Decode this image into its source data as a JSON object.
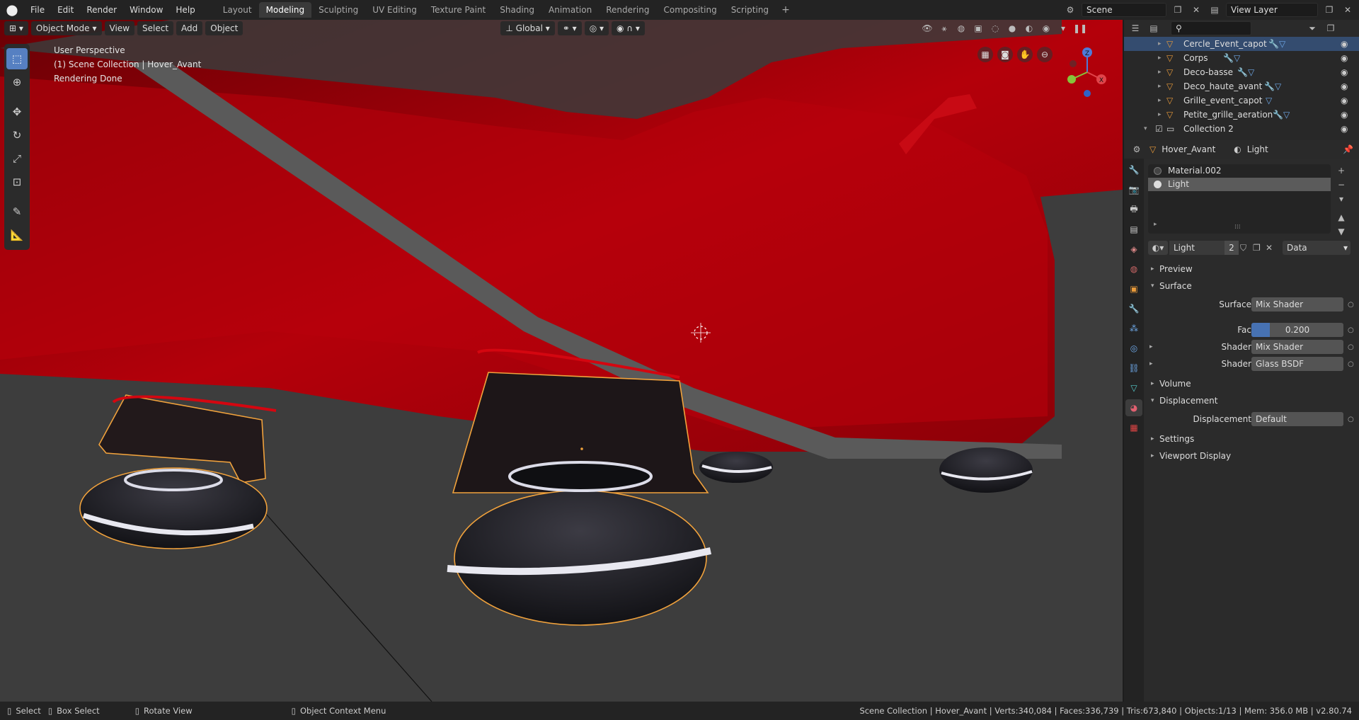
{
  "topbar": {
    "menus": [
      "File",
      "Edit",
      "Render",
      "Window",
      "Help"
    ],
    "workspaces": [
      "Layout",
      "Modeling",
      "Sculpting",
      "UV Editing",
      "Texture Paint",
      "Shading",
      "Animation",
      "Rendering",
      "Compositing",
      "Scripting"
    ],
    "active_workspace": "Modeling",
    "scene": "Scene",
    "view_layer": "View Layer"
  },
  "viewport": {
    "mode": "Object Mode",
    "menus": [
      "View",
      "Select",
      "Add",
      "Object"
    ],
    "orientation": "Global",
    "overlay_lines": [
      "User Perspective",
      "(1) Scene Collection | Hover_Avant",
      "Rendering Done"
    ],
    "gizmo_labels": {
      "z": "Z",
      "x": "X"
    },
    "colors": {
      "body_red": "#c4000a",
      "ground": "#3d3d3d",
      "selection": "#f1a23c"
    }
  },
  "outliner": {
    "rows": [
      {
        "name": "Cercle_Event_capot",
        "selected": true
      },
      {
        "name": "Corps",
        "selected": false
      },
      {
        "name": "Deco-basse",
        "selected": false
      },
      {
        "name": "Deco_haute_avant",
        "selected": false
      },
      {
        "name": "Grille_event_capot",
        "selected": false
      },
      {
        "name": "Petite_grille_aeration",
        "selected": false
      }
    ],
    "collection": "Collection 2"
  },
  "properties": {
    "object": "Hover_Avant",
    "material": "Light",
    "slots": [
      "Material.002",
      "Light"
    ],
    "active_slot": "Light",
    "material_field": "Light",
    "users": "2",
    "link": "Data",
    "panels": {
      "preview": "Preview",
      "surface": "Surface",
      "volume": "Volume",
      "displacement": "Displacement",
      "settings": "Settings",
      "viewport_display": "Viewport Display"
    },
    "surface_label": "Surface",
    "surface_value": "Mix Shader",
    "fac_label": "Fac",
    "fac_value": "0.200",
    "fac_fraction": 0.2,
    "shader1_label": "Shader",
    "shader1_value": "Mix Shader",
    "shader2_label": "Shader",
    "shader2_value": "Glass BSDF",
    "disp_label": "Displacement",
    "disp_value": "Default"
  },
  "status": {
    "select": "Select",
    "box_select": "Box Select",
    "rotate": "Rotate View",
    "context": "Object Context Menu",
    "stats": "Scene Collection | Hover_Avant | Verts:340,084 | Faces:336,739 | Tris:673,840 | Objects:1/13 | Mem: 356.0 MB | v2.80.74"
  }
}
